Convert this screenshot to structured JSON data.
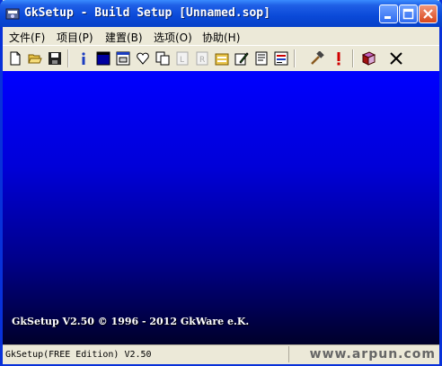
{
  "window": {
    "title": "GkSetup - Build Setup [Unnamed.sop]"
  },
  "menu": {
    "items": [
      "文件(F)",
      "项目(P)",
      "建置(B)",
      "选项(O)",
      "协助(H)"
    ]
  },
  "toolbar": {
    "tools": [
      {
        "name": "new-file-icon",
        "enabled": true
      },
      {
        "name": "open-folder-icon",
        "enabled": true
      },
      {
        "name": "save-icon",
        "enabled": true
      },
      {
        "name": "info-icon",
        "enabled": true
      },
      {
        "name": "window-icon",
        "enabled": true
      },
      {
        "name": "dialog-icon",
        "enabled": true
      },
      {
        "name": "heart-icon",
        "enabled": true
      },
      {
        "name": "copy-icon",
        "enabled": true
      },
      {
        "name": "document-l-icon",
        "enabled": false
      },
      {
        "name": "document-r-icon",
        "enabled": false
      },
      {
        "name": "files-icon",
        "enabled": true
      },
      {
        "name": "edit-icon",
        "enabled": true
      },
      {
        "name": "script-icon",
        "enabled": true
      },
      {
        "name": "registry-icon",
        "enabled": true
      },
      {
        "name": "build-hammer-icon",
        "enabled": true
      },
      {
        "name": "run-exclamation-icon",
        "enabled": true
      },
      {
        "name": "help-book-icon",
        "enabled": true
      },
      {
        "name": "exit-x-icon",
        "enabled": true
      }
    ]
  },
  "client": {
    "copyright": "GkSetup V2.50 © 1996 - 2012 GkWare e.K.",
    "gradient": [
      "#0000ff",
      "#00002a"
    ]
  },
  "statusbar": {
    "text": "GkSetup(FREE Edition) V2.50",
    "watermark": "www.arpun.com"
  }
}
